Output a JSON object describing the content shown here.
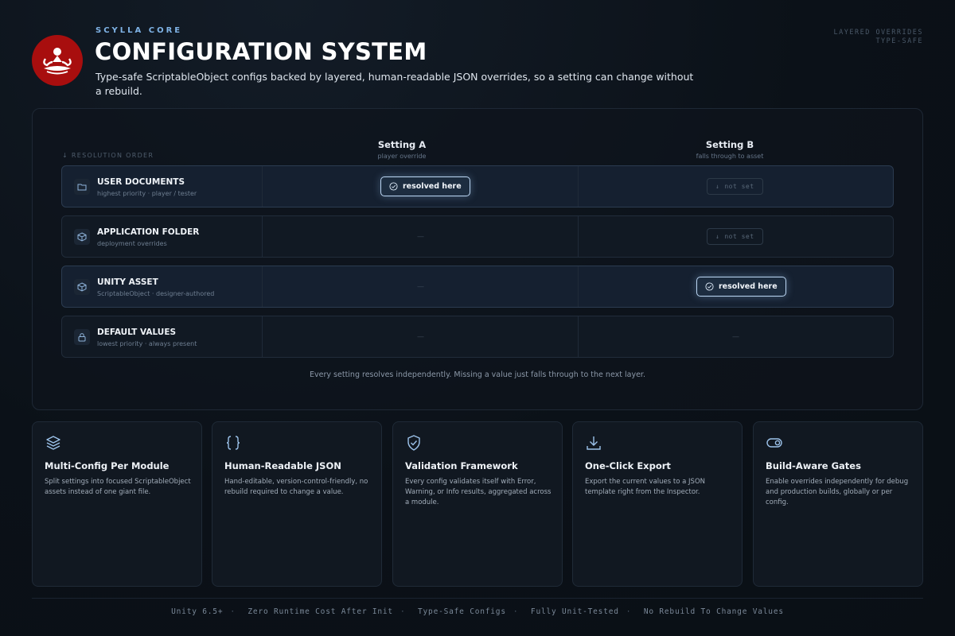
{
  "header": {
    "eyebrow": "SCYLLA CORE",
    "title": "CONFIGURATION SYSTEM",
    "subtitle": "Type-safe ScriptableObject configs backed by layered, human-readable JSON overrides, so a setting can change without a rebuild.",
    "tags": [
      "LAYERED OVERRIDES",
      "TYPE-SAFE"
    ],
    "logo_color": "#a80e0e"
  },
  "resolution": {
    "order_label": "RESOLUTION ORDER",
    "columns": [
      {
        "name": "Setting A",
        "sub": "player override"
      },
      {
        "name": "Setting B",
        "sub": "falls through to asset"
      }
    ],
    "rows": [
      {
        "name": "USER DOCUMENTS",
        "desc": "highest priority · player / tester",
        "icon": "folder-icon",
        "a": "resolved here",
        "b": "not set"
      },
      {
        "name": "APPLICATION FOLDER",
        "desc": "deployment overrides",
        "icon": "cube-icon",
        "a": "—",
        "b": "not set"
      },
      {
        "name": "UNITY ASSET",
        "desc": "ScriptableObject · designer-authored",
        "icon": "cube-icon",
        "a": "—",
        "b": "resolved here"
      },
      {
        "name": "DEFAULT VALUES",
        "desc": "lowest priority · always present",
        "icon": "lock-icon",
        "a": "—",
        "b": "—"
      }
    ],
    "note": "Every setting resolves independently. Missing a value just falls through to the next layer."
  },
  "features": [
    {
      "title": "Multi-Config Per Module",
      "desc": "Split settings into focused ScriptableObject assets instead of one giant file.",
      "icon": "layers-icon"
    },
    {
      "title": "Human-Readable JSON",
      "desc": "Hand-editable, version-control-friendly, no rebuild required to change a value.",
      "icon": "braces-icon"
    },
    {
      "title": "Validation Framework",
      "desc": "Every config validates itself with Error, Warning, or Info results, aggregated across a module.",
      "icon": "shield-check-icon"
    },
    {
      "title": "One-Click Export",
      "desc": "Export the current values to a JSON template right from the Inspector.",
      "icon": "download-icon"
    },
    {
      "title": "Build-Aware Gates",
      "desc": "Enable overrides independently for debug and production builds, globally or per config.",
      "icon": "toggle-icon"
    }
  ],
  "footer": [
    "Unity 6.5+",
    "Zero Runtime Cost After Init",
    "Type-Safe Configs",
    "Fully Unit-Tested",
    "No Rebuild To Change Values"
  ]
}
